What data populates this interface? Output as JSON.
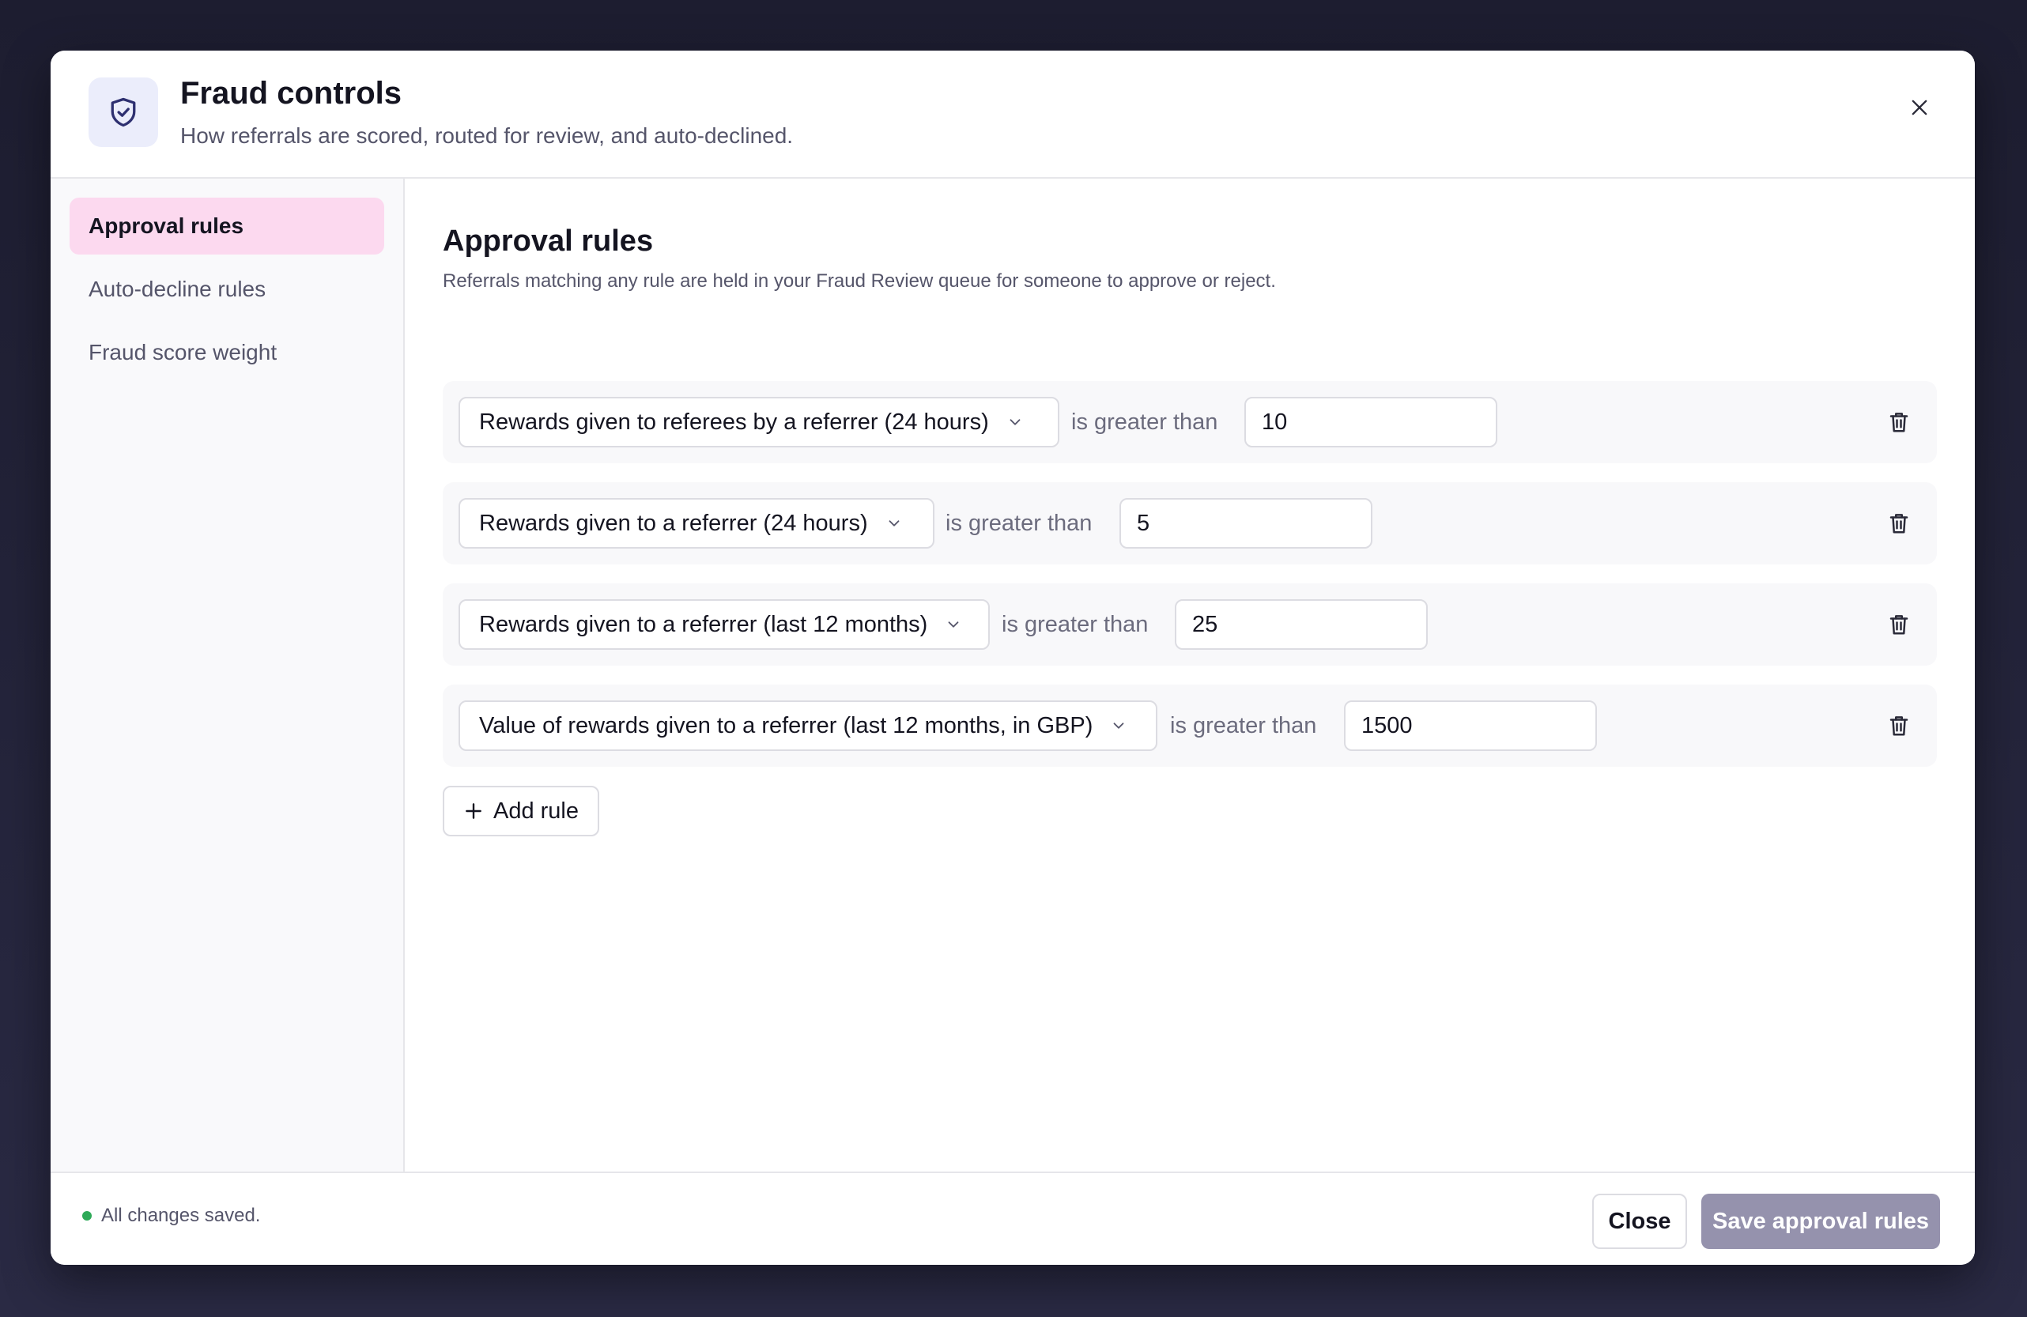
{
  "header": {
    "title": "Fraud controls",
    "subtitle": "How referrals are scored, routed for review, and auto-declined.",
    "icon": "shield-check-icon",
    "close_icon": "close-icon"
  },
  "sidebar": {
    "items": [
      {
        "label": "Approval rules",
        "active": true
      },
      {
        "label": "Auto-decline rules",
        "active": false
      },
      {
        "label": "Fraud score weight",
        "active": false
      }
    ]
  },
  "main": {
    "title": "Approval rules",
    "description": "Referrals matching any rule are held in your Fraud Review queue for someone to approve or reject.",
    "rules": [
      {
        "metric": "Rewards given to referees by a referrer (24 hours)",
        "operator": "is greater than",
        "value": "10"
      },
      {
        "metric": "Rewards given to a referrer (24 hours)",
        "operator": "is greater than",
        "value": "5"
      },
      {
        "metric": "Rewards given to a referrer (last 12 months)",
        "operator": "is greater than",
        "value": "25"
      },
      {
        "metric": "Value of rewards given to a referrer (last 12 months, in GBP)",
        "operator": "is greater than",
        "value": "1500"
      }
    ],
    "add_rule_label": "Add rule"
  },
  "footer": {
    "status": "All changes saved.",
    "status_color": "#2eaa58",
    "close_label": "Close",
    "save_label": "Save approval rules"
  },
  "colors": {
    "accent_active": "#fcd9ef",
    "save_button": "#9592ad",
    "icon_tile": "#ebedfb",
    "icon_stroke": "#2e3070"
  }
}
